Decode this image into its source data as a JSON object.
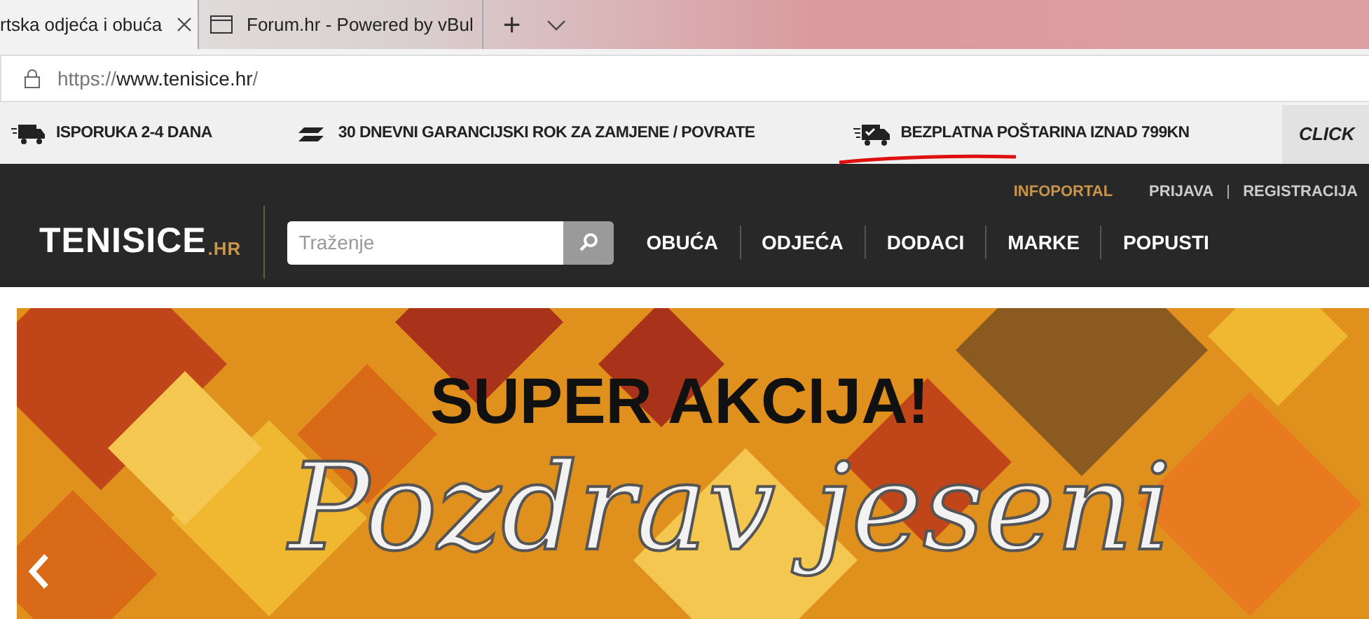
{
  "browser": {
    "tabs": [
      {
        "label": "rtska odjeća i obuća",
        "selected": true,
        "closable": true
      },
      {
        "label": "Forum.hr - Powered by vBul",
        "selected": false,
        "closable": false
      }
    ],
    "new_tab": "+",
    "address": {
      "scheme": "https://",
      "host": "www.tenisice.hr",
      "path": "/"
    }
  },
  "promo_bar": {
    "items": [
      {
        "kind": "truck",
        "text": "ISPORUKA 2-4 DANA",
        "underlined": false
      },
      {
        "kind": "return",
        "text": "30 DNEVNI GARANCIJSKI ROK ZA ZAMJENE / POVRATE",
        "underlined": false
      },
      {
        "kind": "free",
        "text": "BEZPLATNA POŠTARINA IZNAD 799KN",
        "underlined": true
      }
    ],
    "click": "CLICK"
  },
  "header": {
    "top_links": [
      {
        "text": "INFOPORTAL",
        "highlight": true
      },
      {
        "text": "PRIJAVA",
        "highlight": false
      },
      {
        "text": "REGISTRACIJA",
        "highlight": false
      }
    ],
    "logo": {
      "main": "TENISICE",
      "suffix": ".HR"
    },
    "search": {
      "placeholder": "Traženje"
    },
    "nav": [
      "OBUĆA",
      "ODJEĆA",
      "DODACI",
      "MARKE",
      "POPUSTI"
    ]
  },
  "banner": {
    "kind": "picture",
    "headline": "SUPER AKCIJA!",
    "script": "Pozdrav jeseni"
  }
}
